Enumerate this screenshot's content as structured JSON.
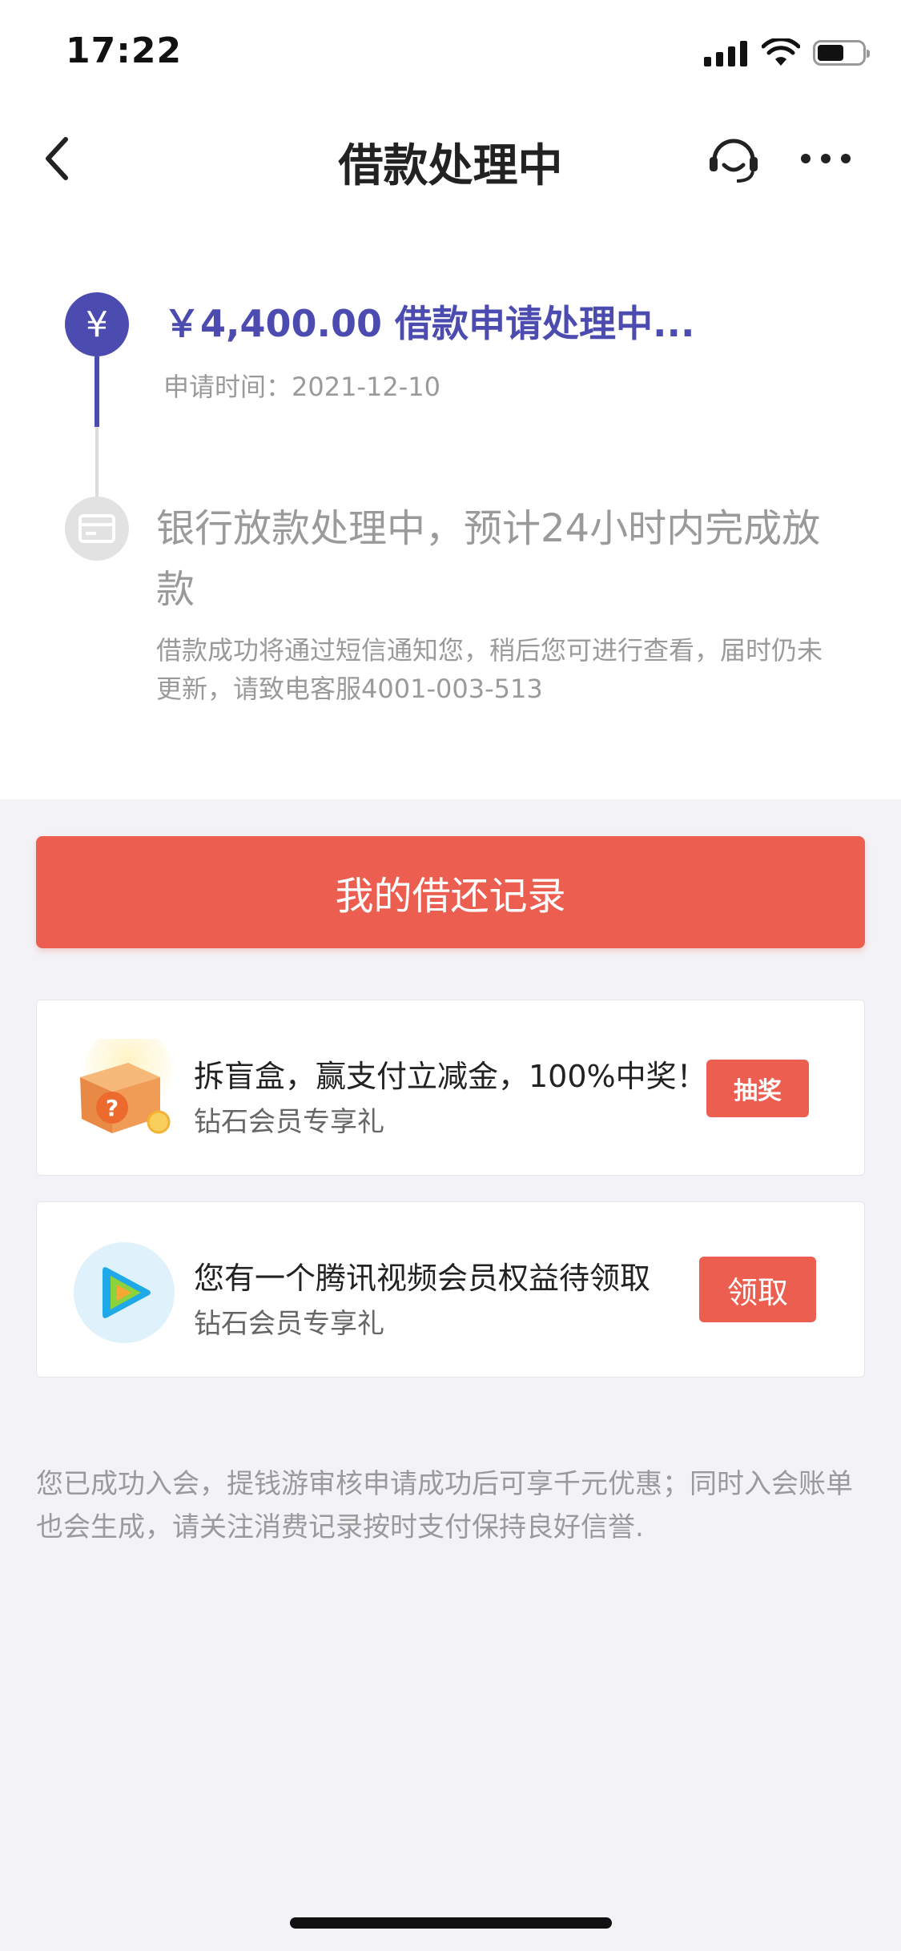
{
  "status_bar": {
    "time": "17:22"
  },
  "nav": {
    "title": "借款处理中"
  },
  "timeline": {
    "step1": {
      "icon_symbol": "¥",
      "title": "￥4,400.00 借款申请处理中...",
      "time": "申请时间：2021-12-10"
    },
    "step2": {
      "title": "银行放款处理中，预计24小时内完成放款",
      "desc": "借款成功将通过短信通知您，稍后您可进行查看，届时仍未更新，请致电客服4001-003-513"
    }
  },
  "main_button": {
    "label": "我的借还记录"
  },
  "cards": [
    {
      "title": "拆盲盒，赢支付立减金，100%中奖！",
      "subtitle": "钻石会员专享礼",
      "button": "抽奖",
      "icon": "blind-box-icon"
    },
    {
      "title": "您有一个腾讯视频会员权益待领取",
      "subtitle": "钻石会员专享礼",
      "button": "领取",
      "icon": "tencent-video-icon"
    }
  ],
  "footer_note": "您已成功入会，提钱游审核申请成功后可享千元优惠；同时入会账单也会生成，请关注消费记录按时支付保持良好信誉.",
  "colors": {
    "accent": "#4b4bb0",
    "button": "#ec5f50",
    "background": "#f3f3f7"
  }
}
